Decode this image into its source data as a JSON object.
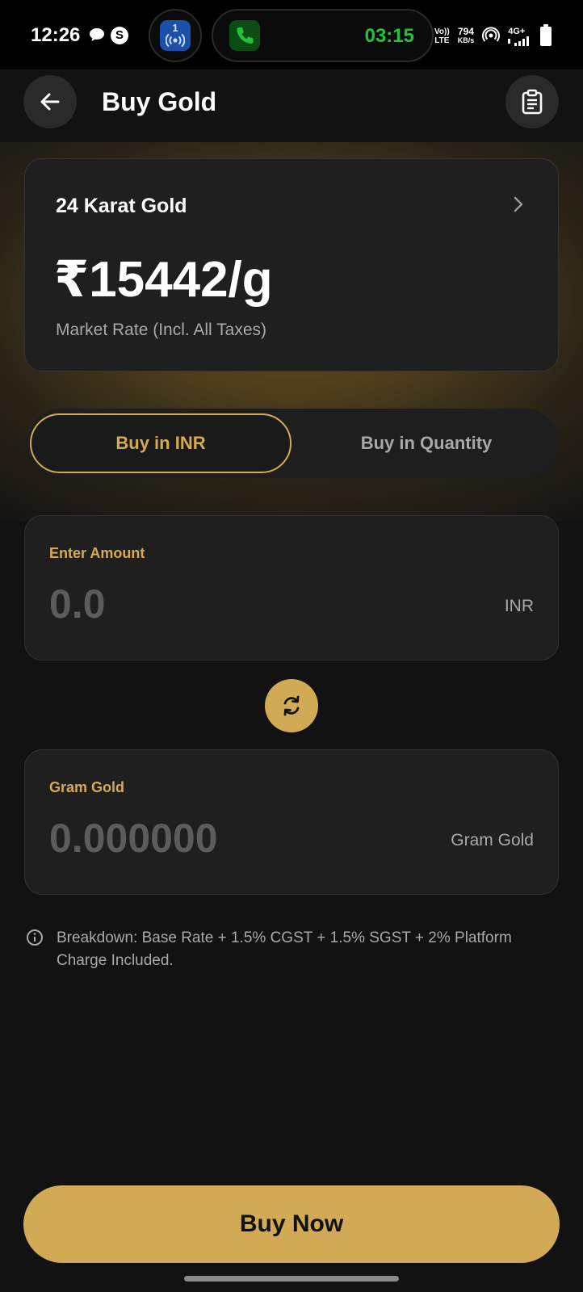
{
  "status_bar": {
    "time": "12:26",
    "radio_badge": "1",
    "call_timer": "03:15",
    "volte_line1": "Vo))",
    "volte_line2": "LTE",
    "speed_value": "794",
    "speed_unit": "KB/s",
    "network": "4G+",
    "colors": {
      "call_green": "#22c33a",
      "radio_blue": "#1b4fa8"
    }
  },
  "header": {
    "title": "Buy Gold",
    "back_icon": "arrow-left-icon",
    "history_icon": "clipboard-icon"
  },
  "rate_card": {
    "karat": "24 Karat Gold",
    "price": "₹15442/g",
    "subtitle": "Market Rate (Incl. All Taxes)"
  },
  "toggle": {
    "options": [
      "Buy in INR",
      "Buy in Quantity"
    ],
    "selected": "Buy in INR"
  },
  "amount_input": {
    "label": "Enter Amount",
    "placeholder": "0.0",
    "unit": "INR"
  },
  "gram_input": {
    "label": "Gram Gold",
    "placeholder": "0.000000",
    "unit": "Gram Gold"
  },
  "breakdown": {
    "text": "Breakdown: Base Rate + 1.5% CGST + 1.5% SGST + 2% Platform Charge Included."
  },
  "buy_button": {
    "label": "Buy Now"
  },
  "colors": {
    "accent_gold": "#d2a955",
    "background": "#121212",
    "card": "#1f1f1f"
  }
}
